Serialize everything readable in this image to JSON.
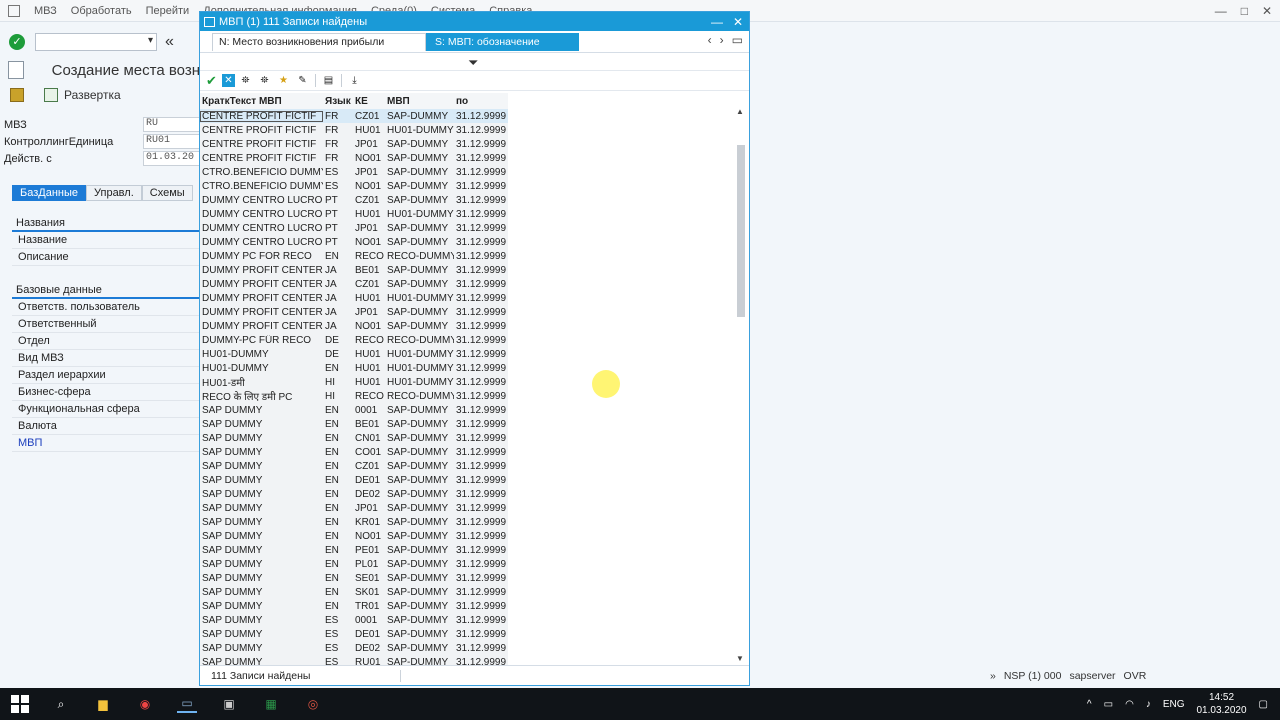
{
  "app": {
    "menu": [
      "МВЗ",
      "Обработать",
      "Перейти",
      "Дополнительная информация",
      "Среда(0)",
      "Система",
      "Справка"
    ],
    "page_title": "Создание места возн",
    "subtoolbar_label": "Развертка",
    "header_fields": [
      {
        "label": "МВЗ",
        "value": "RU"
      },
      {
        "label": "КонтроллингЕдиница",
        "value": "RU01"
      },
      {
        "label": "Действ. с",
        "value": "01.03.20"
      }
    ],
    "tabs": [
      "БазДанные",
      "Управл.",
      "Схемы"
    ],
    "names_section": {
      "title": "Названия",
      "fields": [
        "Название",
        "Описание"
      ]
    },
    "basic_section": {
      "title": "Базовые данные",
      "fields": [
        "Ответств. пользователь",
        "Ответственный",
        "Отдел",
        "Вид МВЗ",
        "Раздел иерархии",
        "Бизнес-сфера",
        "Функциональная сфера",
        "Валюта",
        "МВП"
      ]
    }
  },
  "dialog": {
    "title": "МВП (1)  111 Записи найдены",
    "tab1": "N: Место возникновения прибыли",
    "tab2": "S: МВП: обозначение",
    "columns": [
      "КраткТекст МВП",
      "Язык",
      "КЕ",
      "МВП",
      "по"
    ],
    "rows": [
      [
        "CENTRE PROFIT FICTIF",
        "FR",
        "CZ01",
        "SAP-DUMMY",
        "31.12.9999"
      ],
      [
        "CENTRE PROFIT FICTIF",
        "FR",
        "HU01",
        "HU01-DUMMY",
        "31.12.9999"
      ],
      [
        "CENTRE PROFIT FICTIF",
        "FR",
        "JP01",
        "SAP-DUMMY",
        "31.12.9999"
      ],
      [
        "CENTRE PROFIT FICTIF",
        "FR",
        "NO01",
        "SAP-DUMMY",
        "31.12.9999"
      ],
      [
        "CTRO.BENEFICIO DUMMY",
        "ES",
        "JP01",
        "SAP-DUMMY",
        "31.12.9999"
      ],
      [
        "CTRO.BENEFICIO DUMMY",
        "ES",
        "NO01",
        "SAP-DUMMY",
        "31.12.9999"
      ],
      [
        "DUMMY CENTRO LUCRO",
        "PT",
        "CZ01",
        "SAP-DUMMY",
        "31.12.9999"
      ],
      [
        "DUMMY CENTRO LUCRO",
        "PT",
        "HU01",
        "HU01-DUMMY",
        "31.12.9999"
      ],
      [
        "DUMMY CENTRO LUCRO",
        "PT",
        "JP01",
        "SAP-DUMMY",
        "31.12.9999"
      ],
      [
        "DUMMY CENTRO LUCRO",
        "PT",
        "NO01",
        "SAP-DUMMY",
        "31.12.9999"
      ],
      [
        "DUMMY PC FOR RECO",
        "EN",
        "RECO",
        "RECO-DUMMY",
        "31.12.9999"
      ],
      [
        "DUMMY PROFIT CENTER",
        "JA",
        "BE01",
        "SAP-DUMMY",
        "31.12.9999"
      ],
      [
        "DUMMY PROFIT CENTER",
        "JA",
        "CZ01",
        "SAP-DUMMY",
        "31.12.9999"
      ],
      [
        "DUMMY PROFIT CENTER",
        "JA",
        "HU01",
        "HU01-DUMMY",
        "31.12.9999"
      ],
      [
        "DUMMY PROFIT CENTER",
        "JA",
        "JP01",
        "SAP-DUMMY",
        "31.12.9999"
      ],
      [
        "DUMMY PROFIT CENTER",
        "JA",
        "NO01",
        "SAP-DUMMY",
        "31.12.9999"
      ],
      [
        "DUMMY-PC FÜR RECO",
        "DE",
        "RECO",
        "RECO-DUMMY",
        "31.12.9999"
      ],
      [
        "HU01-DUMMY",
        "DE",
        "HU01",
        "HU01-DUMMY",
        "31.12.9999"
      ],
      [
        "HU01-DUMMY",
        "EN",
        "HU01",
        "HU01-DUMMY",
        "31.12.9999"
      ],
      [
        "HU01-डमी",
        "HI",
        "HU01",
        "HU01-DUMMY",
        "31.12.9999"
      ],
      [
        "RECO के लिए डमी PC",
        "HI",
        "RECO",
        "RECO-DUMMY",
        "31.12.9999"
      ],
      [
        "SAP DUMMY",
        "EN",
        "0001",
        "SAP-DUMMY",
        "31.12.9999"
      ],
      [
        "SAP DUMMY",
        "EN",
        "BE01",
        "SAP-DUMMY",
        "31.12.9999"
      ],
      [
        "SAP DUMMY",
        "EN",
        "CN01",
        "SAP-DUMMY",
        "31.12.9999"
      ],
      [
        "SAP DUMMY",
        "EN",
        "CO01",
        "SAP-DUMMY",
        "31.12.9999"
      ],
      [
        "SAP DUMMY",
        "EN",
        "CZ01",
        "SAP-DUMMY",
        "31.12.9999"
      ],
      [
        "SAP DUMMY",
        "EN",
        "DE01",
        "SAP-DUMMY",
        "31.12.9999"
      ],
      [
        "SAP DUMMY",
        "EN",
        "DE02",
        "SAP-DUMMY",
        "31.12.9999"
      ],
      [
        "SAP DUMMY",
        "EN",
        "JP01",
        "SAP-DUMMY",
        "31.12.9999"
      ],
      [
        "SAP DUMMY",
        "EN",
        "KR01",
        "SAP-DUMMY",
        "31.12.9999"
      ],
      [
        "SAP DUMMY",
        "EN",
        "NO01",
        "SAP-DUMMY",
        "31.12.9999"
      ],
      [
        "SAP DUMMY",
        "EN",
        "PE01",
        "SAP-DUMMY",
        "31.12.9999"
      ],
      [
        "SAP DUMMY",
        "EN",
        "PL01",
        "SAP-DUMMY",
        "31.12.9999"
      ],
      [
        "SAP DUMMY",
        "EN",
        "SE01",
        "SAP-DUMMY",
        "31.12.9999"
      ],
      [
        "SAP DUMMY",
        "EN",
        "SK01",
        "SAP-DUMMY",
        "31.12.9999"
      ],
      [
        "SAP DUMMY",
        "EN",
        "TR01",
        "SAP-DUMMY",
        "31.12.9999"
      ],
      [
        "SAP DUMMY",
        "ES",
        "0001",
        "SAP-DUMMY",
        "31.12.9999"
      ],
      [
        "SAP DUMMY",
        "ES",
        "DE01",
        "SAP-DUMMY",
        "31.12.9999"
      ],
      [
        "SAP DUMMY",
        "ES",
        "DE02",
        "SAP-DUMMY",
        "31.12.9999"
      ],
      [
        "SAP DUMMY",
        "ES",
        "RU01",
        "SAP-DUMMY",
        "31.12.9999"
      ]
    ],
    "status": "111 Записи найдены"
  },
  "sap_status": {
    "session": "NSP (1) 000",
    "server": "sapserver",
    "mode": "OVR"
  },
  "taskbar": {
    "lang": "ENG",
    "time": "14:52",
    "date": "01.03.2020"
  },
  "colors": {
    "accent": "#1a9ad7",
    "tab_active": "#1d7bd6"
  }
}
